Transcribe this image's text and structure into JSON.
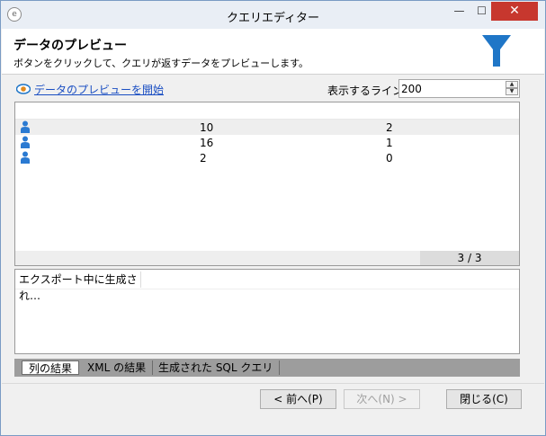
{
  "window": {
    "title": "クエリエディター",
    "controls": {
      "minimize": "—",
      "maximize": "☐",
      "close": "✕"
    }
  },
  "header": {
    "title": "データのプレビュー",
    "subtitle": "ボタンをクリックして、クエリが返すデータをプレビューします。",
    "icon": "filter-icon",
    "accent_color": "#1f76c7"
  },
  "toolbar": {
    "preview_link": "データのプレビューを開始",
    "lines_label": "表示するライン:",
    "lines_value": "200"
  },
  "results": {
    "rows": [
      {
        "col1": "10",
        "col2": "2",
        "selected": true
      },
      {
        "col1": "16",
        "col2": "1",
        "selected": false
      },
      {
        "col1": "2",
        "col2": "0",
        "selected": false
      }
    ],
    "count": "3 / 3"
  },
  "output": {
    "status": "エクスポート中に生成され…"
  },
  "tabs": [
    {
      "label": "列の結果",
      "active": true
    },
    {
      "label": "XML の結果",
      "active": false
    },
    {
      "label": "生成された SQL クエリ",
      "active": false
    }
  ],
  "buttons": {
    "prev": "< 前へ(P)",
    "next": "次へ(N) >",
    "close": "閉じる(C)"
  }
}
